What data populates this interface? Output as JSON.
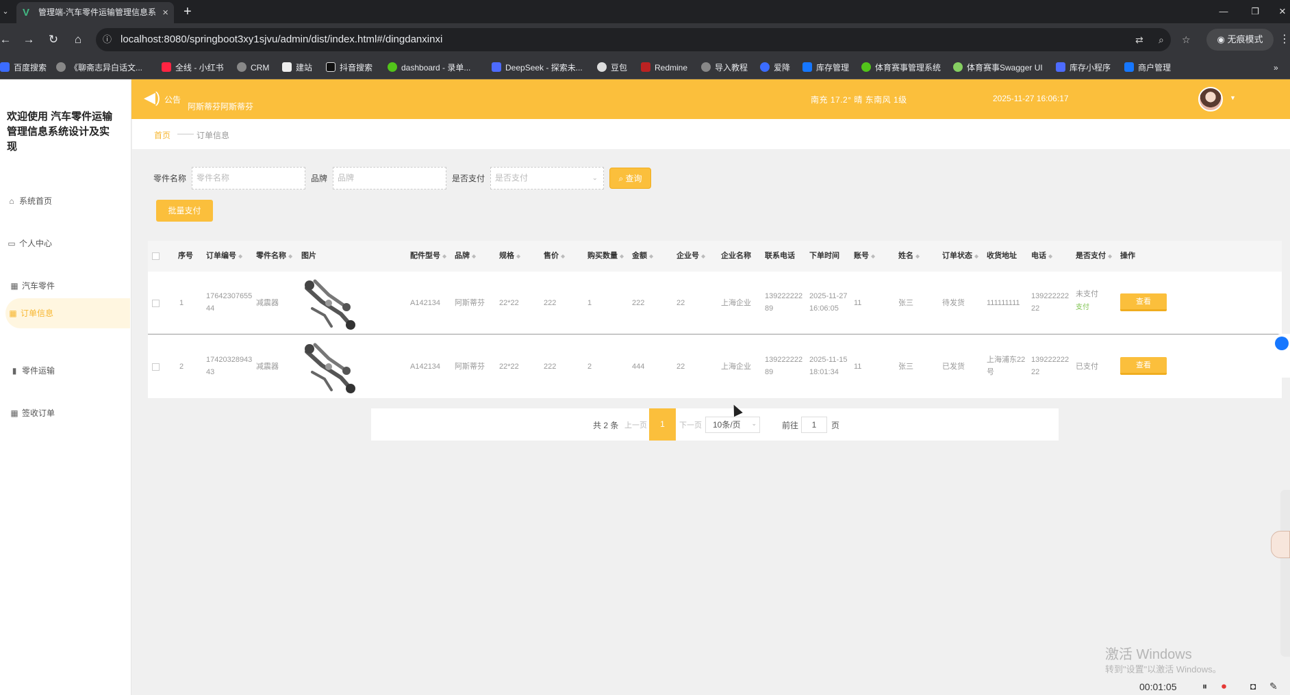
{
  "browser": {
    "tab_title": "管理端-汽车零件运输管理信息系",
    "url": "localhost:8080/springboot3xy1sjvu/admin/dist/index.html#/dingdanxinxi",
    "incognito_label": "无痕模式",
    "bookmarks": [
      "百度搜索",
      "《聊斋志异白话文...",
      "全线 - 小红书",
      "CRM",
      "建站",
      "抖音搜索",
      "dashboard - 录单...",
      "DeepSeek - 探索未...",
      "豆包",
      "Redmine",
      "导入教程",
      "爱降",
      "库存管理",
      "体育赛事管理系统",
      "体育赛事Swagger UI",
      "库存小程序",
      "商户管理"
    ]
  },
  "sidebar": {
    "title": "欢迎使用 汽车零件运输管理信息系统设计及实现",
    "items": [
      {
        "label": "系统首页",
        "icon": "home-icon"
      },
      {
        "label": "个人中心",
        "icon": "user-card-icon"
      },
      {
        "label": "汽车零件",
        "icon": "grid-icon"
      },
      {
        "label": "订单信息",
        "icon": "grid-icon"
      },
      {
        "label": "零件运输",
        "icon": "bar-chart-icon"
      },
      {
        "label": "签收订单",
        "icon": "grid-icon"
      }
    ],
    "active_index": 3
  },
  "header": {
    "notice_label": "公告",
    "notice_text": "阿斯蒂芬阿斯蒂芬",
    "weather": "南充  17.2°  晴  东南风  1级",
    "datetime": "2025-11-27 16:06:17"
  },
  "breadcrumb": {
    "home": "首页",
    "separator": "——",
    "current": "订单信息"
  },
  "search": {
    "part_name_label": "零件名称",
    "part_name_placeholder": "零件名称",
    "brand_label": "品牌",
    "brand_placeholder": "品牌",
    "paid_label": "是否支付",
    "paid_placeholder": "是否支付",
    "query_button": "查询",
    "batch_pay_button": "批量支付"
  },
  "table": {
    "columns": [
      "序号",
      "订单编号",
      "零件名称",
      "图片",
      "配件型号",
      "品牌",
      "规格",
      "售价",
      "购买数量",
      "金额",
      "企业号",
      "企业名称",
      "联系电话",
      "下单时间",
      "账号",
      "姓名",
      "订单状态",
      "收货地址",
      "电话",
      "是否支付",
      "操作"
    ],
    "rows": [
      {
        "index": "1",
        "order_no_1": "17642307655",
        "order_no_2": "44",
        "part_name": "减震器",
        "model": "A142134",
        "brand": "阿斯蒂芬",
        "spec": "22*22",
        "price": "222",
        "quantity": "1",
        "amount": "222",
        "company_no": "22",
        "company_name": "上海企业",
        "contact_1": "139222222",
        "contact_2": "89",
        "time_1": "2025-11-27",
        "time_2": "16:06:05",
        "account": "11",
        "name": "张三",
        "status": "待发货",
        "address_1": "111111111",
        "address_2": "",
        "phone_1": "139222222",
        "phone_2": "22",
        "paid": "未支付",
        "pay_link": "支付",
        "action": "查看"
      },
      {
        "index": "2",
        "order_no_1": "17420328943",
        "order_no_2": "43",
        "part_name": "减震器",
        "model": "A142134",
        "brand": "阿斯蒂芬",
        "spec": "22*22",
        "price": "222",
        "quantity": "2",
        "amount": "444",
        "company_no": "22",
        "company_name": "上海企业",
        "contact_1": "139222222",
        "contact_2": "89",
        "time_1": "2025-11-15",
        "time_2": "18:01:34",
        "account": "11",
        "name": "张三",
        "status": "已发货",
        "address_1": "上海浦东22",
        "address_2": "号",
        "phone_1": "139222222",
        "phone_2": "22",
        "paid": "已支付",
        "pay_link": "",
        "action": "查看"
      }
    ]
  },
  "pagination": {
    "total": "共 2 条",
    "prev": "上一页",
    "current": "1",
    "next": "下一页",
    "page_size": "10条/页",
    "goto_label": "前往",
    "goto_value": "1",
    "goto_unit": "页"
  },
  "overlay": {
    "watermark_title": "激活 Windows",
    "watermark_sub": "转到\"设置\"以激活 Windows。",
    "record_time": "00:01:05"
  },
  "colors": {
    "accent": "#fbbf3c",
    "link_green": "#7cc24d"
  }
}
